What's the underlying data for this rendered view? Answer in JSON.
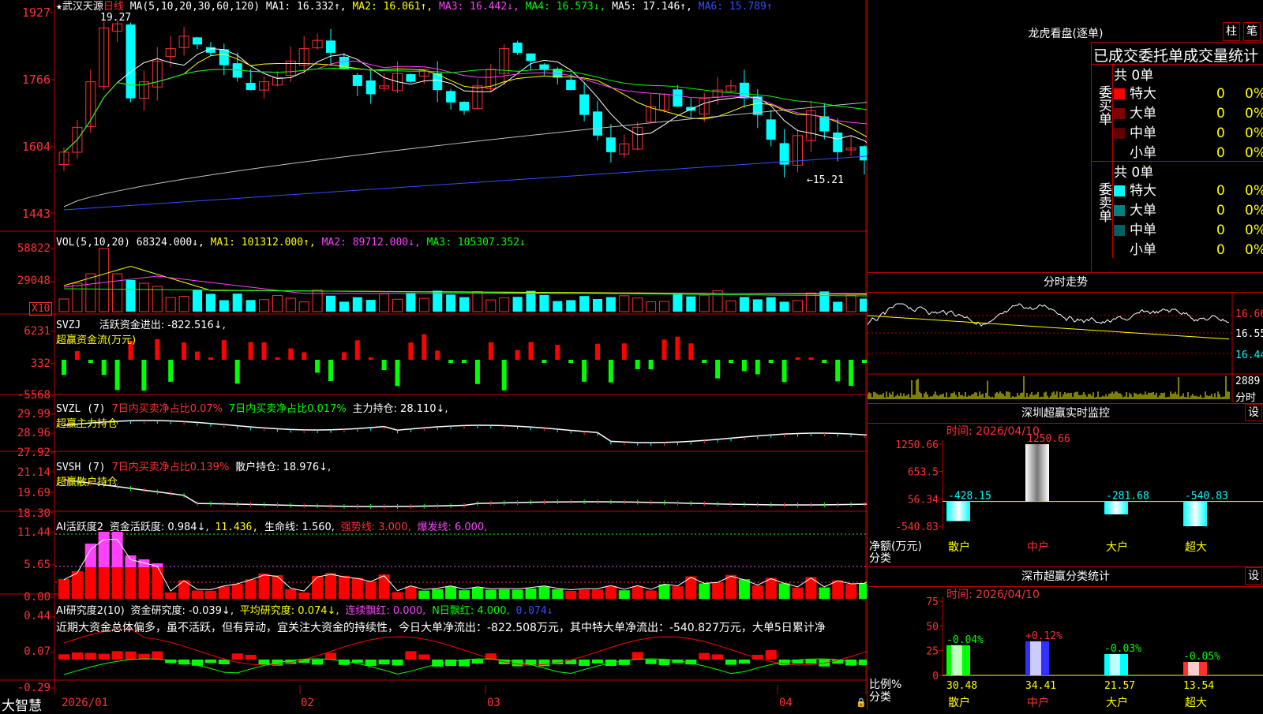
{
  "stock": {
    "star": "★",
    "name": "武汉天源",
    "period": "日线"
  },
  "main": {
    "ma_params": "MA(5,10,20,30,60,120)",
    "ma1": "MA1: 16.332↑,",
    "ma2": "MA2: 16.061↑,",
    "ma3": "MA3: 16.442↓,",
    "ma4": "MA4: 16.573↓,",
    "ma5": "MA5: 17.146↑,",
    "ma6": "MA6: 15.789↑",
    "y_labels": [
      "1927",
      "1766",
      "1604",
      "1443"
    ],
    "high_marker": "19.27",
    "low_marker": "←15.21"
  },
  "vol": {
    "params": "VOL(5,10,20)",
    "value": "68324.000↓,",
    "ma1": "MA1: 101312.000↑,",
    "ma2": "MA2: 89712.000↓,",
    "ma3": "MA3: 105307.352↓",
    "y_labels": [
      "58822",
      "29048"
    ],
    "unit": "X10"
  },
  "svzj": {
    "name": "SVZJ",
    "text": "活跃资金进出: -822.516↓,",
    "subtitle": "超赢资金流(万元)",
    "y_labels": [
      "6231",
      "332",
      "-5568"
    ]
  },
  "svzl": {
    "name": "SVZL  (7)",
    "t1": "7日内买卖净占比0.07%",
    "t2": "7日内买卖净占比0.017%",
    "t3": "主力持仓: 28.110↓,",
    "subtitle": "超赢主力持仓",
    "y_labels": [
      "29.99",
      "28.96",
      "27.92"
    ]
  },
  "svsh": {
    "name": "SVSH  (7)",
    "t1": "7日内买卖净占比0.139%",
    "t2": "散户持仓: 18.976↓,",
    "subtitle": "超赢散户持仓",
    "y_labels": [
      "21.14",
      "19.69",
      "18.30"
    ]
  },
  "ai1": {
    "name": "AI活跃度2",
    "t1": "资金活跃度: 0.984↓,",
    "t2": "11.436,",
    "t3": "生命线: 1.560,",
    "t4": "强势线: 3.000,",
    "t5": "爆发线: 6.000,",
    "y_labels": [
      "11.44",
      "5.65",
      "0.00"
    ]
  },
  "ai2": {
    "name": "AI研究度2(10)",
    "t1": "资金研究度: -0.039↓,",
    "t2": "平均研究度: 0.074↓,",
    "t3": "连续飘红: 0.000,",
    "t4": "N日飘红: 4.000,",
    "t5": "0.074↓",
    "commentary": "近期大资金总体偏多，虽不活跃，但有异动，宜关注大资金的持续性，今日大单净流出：-822.508万元，其中特大单净流出：-540.827万元，大单5日累计净",
    "y_labels": [
      "0.44",
      "0.07",
      "-0.29"
    ]
  },
  "xaxis": {
    "labels": [
      "2026/01",
      "02",
      "03",
      "04"
    ]
  },
  "brand": "大智慧",
  "lhb": {
    "title": "龙虎看盘(逐单)",
    "btn1": "柱",
    "btn2": "笔",
    "header": "已成交委托单成交量统计",
    "buy": {
      "side": "委买单",
      "total": "共 0单",
      "rows": [
        {
          "label": "特大",
          "count": "0",
          "pct": "0%",
          "color": "#ff0000"
        },
        {
          "label": "大单",
          "count": "0",
          "pct": "0%",
          "color": "#800000"
        },
        {
          "label": "中单",
          "count": "0",
          "pct": "0%",
          "color": "#600000"
        },
        {
          "label": "小单",
          "count": "0",
          "pct": "0%",
          "color": "#000000"
        }
      ]
    },
    "sell": {
      "side": "委卖单",
      "total": "共 0单",
      "rows": [
        {
          "label": "特大",
          "count": "0",
          "pct": "0%",
          "color": "#00ffff"
        },
        {
          "label": "大单",
          "count": "0",
          "pct": "0%",
          "color": "#008080"
        },
        {
          "label": "中单",
          "count": "0",
          "pct": "0%",
          "color": "#006060"
        },
        {
          "label": "小单",
          "count": "0",
          "pct": "0%",
          "color": "#000000"
        }
      ]
    }
  },
  "intraday": {
    "title": "分时走势",
    "prices": [
      "16.66",
      "16.55",
      "16.44"
    ],
    "vol": "2889",
    "unit": "分时"
  },
  "szrt": {
    "title": "深圳超赢实时监控",
    "setting": "设",
    "time": "时间: 2026/04/10",
    "y_labels": [
      "1250.66",
      "653.5",
      "56.34",
      "-540.83"
    ],
    "axis_title": "净额(万元)",
    "axis_sub": "分类",
    "bars": [
      {
        "cat": "散户",
        "value": -428.15,
        "label": "-428.15"
      },
      {
        "cat": "中户",
        "value": 1250.66,
        "label": "1250.66"
      },
      {
        "cat": "大户",
        "value": -281.68,
        "label": "-281.68"
      },
      {
        "cat": "超大",
        "value": -540.83,
        "label": "-540.83"
      }
    ]
  },
  "szcls": {
    "title": "深市超赢分类统计",
    "setting": "设",
    "time": "时间: 2026/04/10",
    "y_labels": [
      "75",
      "50",
      "25",
      "0"
    ],
    "axis_title": "比例%",
    "axis_sub": "分类",
    "bars": [
      {
        "cat": "散户",
        "value": 30.48,
        "change": "-0.04%",
        "color": "#00ff00"
      },
      {
        "cat": "中户",
        "value": 34.41,
        "change": "+0.12%",
        "color": "#3030ff"
      },
      {
        "cat": "大户",
        "value": 21.57,
        "change": "-0.03%",
        "color": "#00ffff"
      },
      {
        "cat": "超大",
        "value": 13.54,
        "change": "-0.05%",
        "color": "#ff3030"
      }
    ],
    "value_labels": [
      "30.48",
      "34.41",
      "21.57",
      "13.54"
    ]
  },
  "colors": {
    "up": "#ff3030",
    "down": "#00ffff",
    "grid": "#c00000"
  }
}
